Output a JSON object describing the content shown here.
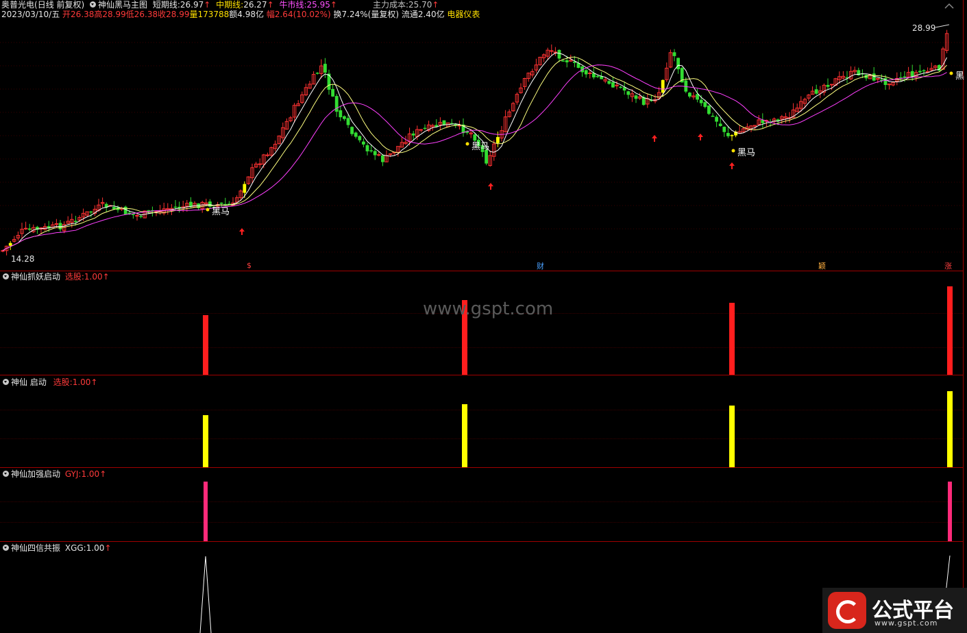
{
  "main": {
    "stock_name": "奥普光电",
    "period": "(日线 前复权)",
    "indicator_name": "神仙黑马主图",
    "short_line_label": "短期线:",
    "short_line_value": "26.97",
    "mid_line_label": "中期线:",
    "mid_line_value": "26.27",
    "bull_line_label": "牛市线:",
    "bull_line_value": "25.95",
    "cost_label": "主力成本:",
    "cost_value": "25.70",
    "date": "2023/03/10/五",
    "open": "开26.38",
    "high": "高28.99",
    "low": "低26.38",
    "close": "收28.99",
    "volume": "量173788",
    "amount": "额4.98亿",
    "change": "幅2.64(10.02%)",
    "turnover": "换7.24%(量复权)",
    "float": "流通2.40亿",
    "sector": "电器仪表",
    "max_price_label": "28.99",
    "min_price_label": "14.28",
    "heima_label": "黑马",
    "heima_edge_label": "黑",
    "events": [
      "$",
      "财",
      "颖",
      "涨"
    ]
  },
  "panel1": {
    "name": "神仙抓妖启动",
    "field": "选股:",
    "value": "1.00"
  },
  "panel2": {
    "name": "神仙 启动",
    "field": "选股:",
    "value": "1.00"
  },
  "panel3": {
    "name": "神仙加强启动",
    "field": "GYJ:",
    "value": "1.00"
  },
  "panel4": {
    "name": "神仙四信共振",
    "field": "XGG:",
    "value": "1.00"
  },
  "arrow_glyph": "↑",
  "watermark": "www.gspt.com",
  "logo": {
    "text": "公式平台",
    "url": "www.gspt.com"
  },
  "colors": {
    "up": "#ff3232",
    "down": "#32dc32",
    "signal_yellow": "#ffff00",
    "short_line": "#ffffff",
    "mid_line": "#ffff80",
    "bull_line": "#ff40ff",
    "panel1_bar": "#ff1e1e",
    "panel2_bar": "#ffff00",
    "panel3_bar": "#ff2a7a",
    "panel4_line": "#ffffff"
  }
}
